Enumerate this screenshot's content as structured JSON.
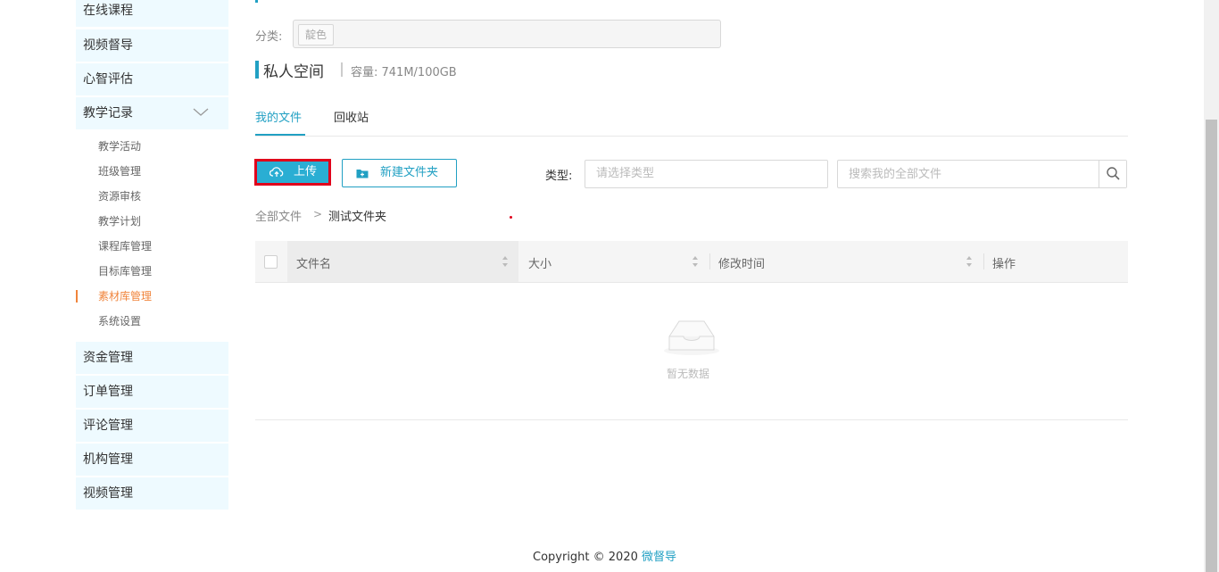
{
  "sidebar": {
    "items_top": [
      "在线课程",
      "视频督导",
      "心智评估",
      "教学记录"
    ],
    "sub_items": [
      "教学活动",
      "班级管理",
      "资源审核",
      "教学计划",
      "课程库管理",
      "目标库管理",
      "素材库管理",
      "系统设置"
    ],
    "active_sub": "素材库管理",
    "items_bottom": [
      "资金管理",
      "订单管理",
      "评论管理",
      "机构管理",
      "视频管理"
    ]
  },
  "category": {
    "label": "分类:",
    "tag": "靛色"
  },
  "space": {
    "title": "私人空间",
    "capacity": "容量: 741M/100GB"
  },
  "tabs": [
    "我的文件",
    "回收站"
  ],
  "toolbar": {
    "upload_label": "上传",
    "new_folder_label": "新建文件夹",
    "type_label": "类型:",
    "type_placeholder": "请选择类型",
    "search_placeholder": "搜索我的全部文件"
  },
  "breadcrumb": {
    "root": "全部文件",
    "sep": ">",
    "current": "测试文件夹"
  },
  "table": {
    "columns": [
      "文件名",
      "大小",
      "修改时间",
      "操作"
    ],
    "empty_text": "暂无数据"
  },
  "footer": {
    "copyright": "Copyright © 2020",
    "brand": "微督导"
  },
  "colors": {
    "accent": "#21a0c3",
    "active_nav": "#f0843b",
    "highlight": "#e0001b"
  }
}
